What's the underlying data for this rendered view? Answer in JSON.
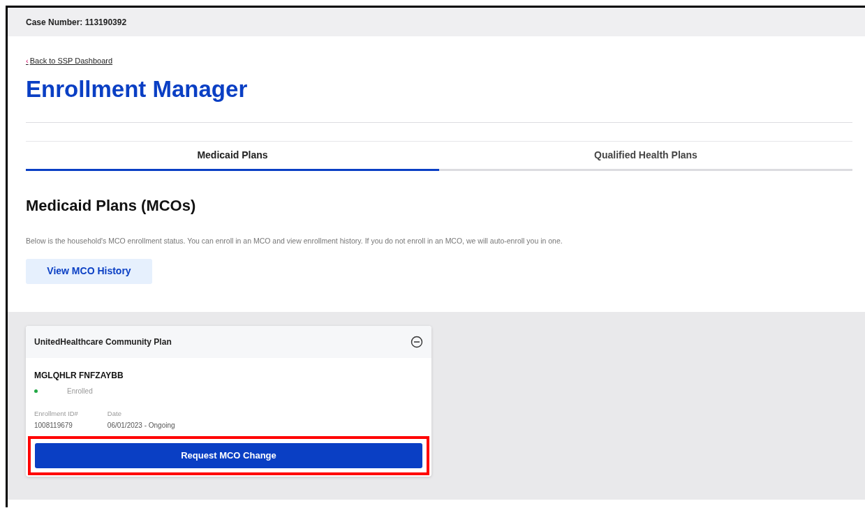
{
  "header": {
    "case_number": "Case Number: 113190392"
  },
  "back_link": {
    "arrow": "‹",
    "label": "Back to SSP Dashboard"
  },
  "title": "Enrollment Manager",
  "tabs": [
    {
      "label": "Medicaid Plans",
      "selected": true
    },
    {
      "label": "Qualified Health Plans",
      "selected": false
    }
  ],
  "section": {
    "heading": "Medicaid Plans (MCOs)",
    "description": "Below is the household's MCO enrollment status. You can enroll in an MCO and view enrollment history. If you do not enroll in an MCO, we will auto-enroll you in one.",
    "button": "View MCO History"
  },
  "card": {
    "title": "UnitedHealthcare Community Plan",
    "expanded": true,
    "member": "MGLQHLR FNFZAYBB",
    "status": {
      "kind": "enrolled",
      "label": "Enrolled"
    },
    "fields": [
      {
        "label": "Enrollment ID#",
        "value": "1008119679"
      },
      {
        "label": "Date",
        "value": "06/01/2023 - Ongoing"
      }
    ],
    "action": {
      "label": "Request MCO Change",
      "highlighted": true
    }
  }
}
